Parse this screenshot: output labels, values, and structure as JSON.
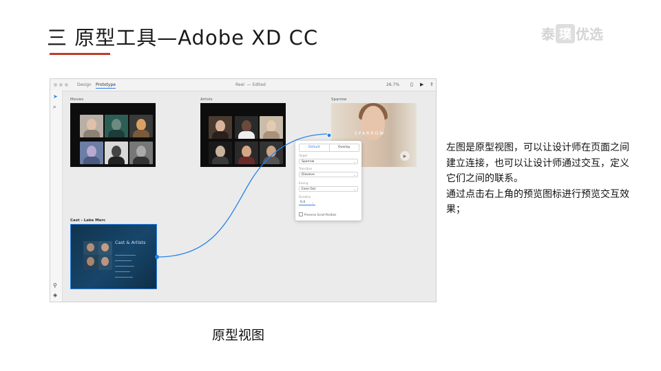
{
  "slide": {
    "title": "三 原型工具—Adobe XD CC",
    "accent_color": "#c0392b"
  },
  "logo": {
    "char1": "泰",
    "char2": "璞",
    "char3": "优选"
  },
  "app": {
    "tabs": [
      "Design",
      "Prototype"
    ],
    "doc_title": "Reel",
    "doc_sep": "—",
    "doc_status": "Edited",
    "zoom": "26.7%",
    "icons": {
      "select": "arrow-pointer-icon",
      "zoom": "magnifier-icon",
      "plugins": "plugins-icon",
      "layers": "layers-icon",
      "preview": "play-icon",
      "share": "share-icon",
      "device": "device-icon"
    }
  },
  "artboards": {
    "movies": {
      "label": "Movies"
    },
    "artists": {
      "label": "Artists"
    },
    "sparrow": {
      "label": "Sparrow",
      "word": "SPARROW"
    },
    "cast": {
      "label": "Cast - Lake Merc",
      "title": "Cast & Artists"
    }
  },
  "panel": {
    "tab_default": "Default",
    "tab_overlay": "Overlay",
    "target_label": "Target",
    "target_value": "Sparrow",
    "transition_label": "Transition",
    "transition_value": "Dissolve",
    "easing_label": "Easing",
    "easing_value": "Ease Out",
    "duration_label": "Duration",
    "duration_value": "0.4",
    "checkbox_label": "Preserve Scroll Position",
    "accent": "#2680eb"
  },
  "description": {
    "p1": "左图是原型视图，可以让设计师在页面之间建立连接，也可以让设计师通过交互，定义它们之间的联系。",
    "p2": "通过点击右上角的预览图标进行预览交互效果；"
  },
  "caption": "原型视图"
}
